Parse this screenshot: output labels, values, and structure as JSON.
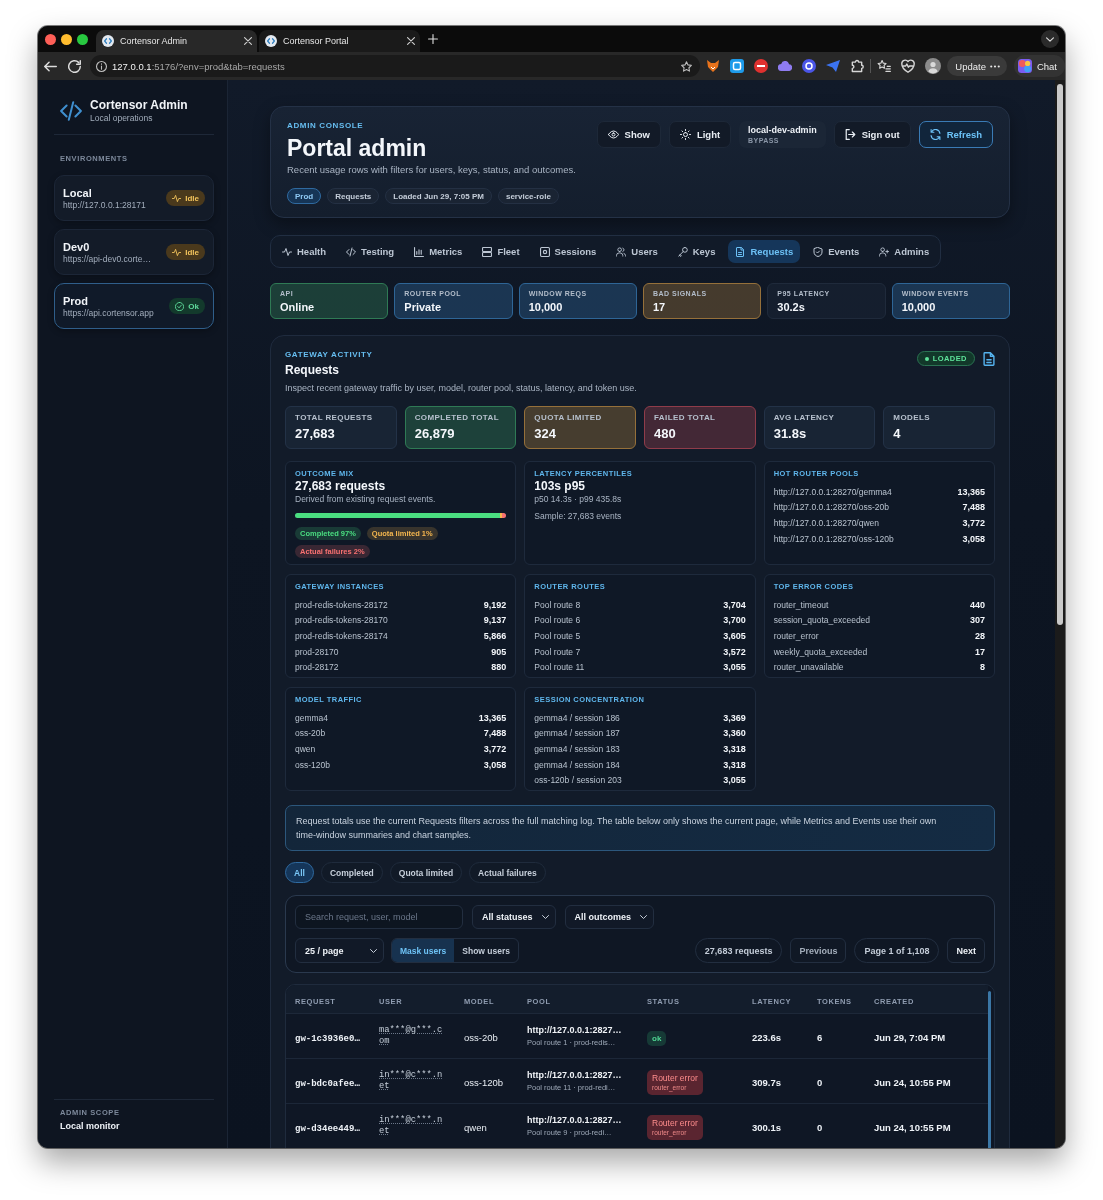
{
  "browser": {
    "tabs": [
      {
        "title": "Cortensor Admin",
        "selected": true
      },
      {
        "title": "Cortensor Portal",
        "selected": false
      }
    ],
    "url": {
      "host": "127.0.0.1",
      "path": ":5176/?env=prod&tab=requests"
    },
    "update_button": "Update",
    "chat_button": "Chat"
  },
  "sidebar": {
    "title": "Cortensor Admin",
    "subtitle": "Local operations",
    "section_label": "ENVIRONMENTS",
    "environments": [
      {
        "name": "Local",
        "url": "http://127.0.0.1:28171",
        "status": {
          "label": "Idle",
          "kind": "idle"
        },
        "selected": false
      },
      {
        "name": "Dev0",
        "url": "https://api-dev0.corte…",
        "status": {
          "label": "Idle",
          "kind": "idle"
        },
        "selected": false
      },
      {
        "name": "Prod",
        "url": "https://api.cortensor.app",
        "status": {
          "label": "Ok",
          "kind": "ok"
        },
        "selected": true
      }
    ],
    "footer_label": "ADMIN SCOPE",
    "footer_value": "Local monitor"
  },
  "header": {
    "eyebrow": "ADMIN CONSOLE",
    "title": "Portal admin",
    "description": "Recent usage rows with filters for users, keys, status, and outcomes.",
    "chips": [
      {
        "label": "Prod",
        "kind": "environment"
      },
      {
        "label": "Requests",
        "kind": "tag"
      },
      {
        "label": "Loaded Jun 29, 7:05 PM",
        "kind": "tag"
      },
      {
        "label": "service-role",
        "kind": "tag"
      }
    ],
    "show_button": "Show",
    "theme_button": "Light",
    "account": {
      "name": "local-dev-admin",
      "mode": "BYPASS"
    },
    "sign_out_button": "Sign out",
    "refresh_button": "Refresh"
  },
  "nav_tabs": [
    {
      "label": "Health",
      "selected": false
    },
    {
      "label": "Testing",
      "selected": false
    },
    {
      "label": "Metrics",
      "selected": false
    },
    {
      "label": "Fleet",
      "selected": false
    },
    {
      "label": "Sessions",
      "selected": false
    },
    {
      "label": "Users",
      "selected": false
    },
    {
      "label": "Keys",
      "selected": false
    },
    {
      "label": "Requests",
      "selected": true
    },
    {
      "label": "Events",
      "selected": false
    },
    {
      "label": "Admins",
      "selected": false
    }
  ],
  "stat_tiles": [
    {
      "label": "API",
      "value": "Online",
      "color": "#2f7a55"
    },
    {
      "label": "ROUTER POOL",
      "value": "Private",
      "color": "#2e6596"
    },
    {
      "label": "WINDOW REQS",
      "value": "10,000",
      "color": "#2e6596"
    },
    {
      "label": "BAD SIGNALS",
      "value": "17",
      "color": "#95703a"
    },
    {
      "label": "P95 LATENCY",
      "value": "30.2s",
      "color": "#1f2a3b"
    },
    {
      "label": "WINDOW EVENTS",
      "value": "10,000",
      "color": "#2e6596"
    }
  ],
  "requests": {
    "eyebrow": "GATEWAY ACTIVITY",
    "title": "Requests",
    "description": "Inspect recent gateway traffic by user, model, router pool, status, latency, and token use.",
    "status_badge": "LOADED",
    "totals": [
      {
        "label": "TOTAL REQUESTS",
        "value": "27,683",
        "color": "#233247"
      },
      {
        "label": "COMPLETED TOTAL",
        "value": "26,879",
        "color": "#2f7a55"
      },
      {
        "label": "QUOTA LIMITED",
        "value": "324",
        "color": "#95703a"
      },
      {
        "label": "FAILED TOTAL",
        "value": "480",
        "color": "#8f3c4a"
      },
      {
        "label": "AVG LATENCY",
        "value": "31.8s",
        "color": "#233247"
      },
      {
        "label": "MODELS",
        "value": "4",
        "color": "#233247"
      }
    ],
    "cards": [
      {
        "kind": "outcome",
        "title": "OUTCOME MIX",
        "headline": "27,683 requests",
        "note": "Derived from existing request events.",
        "outcomes": [
          {
            "label": "Completed 97%",
            "level": 0.97,
            "color": "#4ade80"
          },
          {
            "label": "Quota limited 1%",
            "level": 0.01,
            "color": "#f5b74f"
          },
          {
            "label": "Actual failures 2%",
            "level": 0.02,
            "color": "#f87171"
          }
        ]
      },
      {
        "kind": "latency",
        "title": "LATENCY PERCENTILES",
        "headline": "103s p95",
        "detail": "p50 14.3s · p99 435.8s",
        "sample": "Sample: 27,683 events"
      },
      {
        "kind": "list",
        "title": "HOT ROUTER POOLS",
        "rows": [
          {
            "label": "http://127.0.0.1:28270/gemma4",
            "value": "13,365"
          },
          {
            "label": "http://127.0.0.1:28270/oss-20b",
            "value": "7,488"
          },
          {
            "label": "http://127.0.0.1:28270/qwen",
            "value": "3,772"
          },
          {
            "label": "http://127.0.0.1:28270/oss-120b",
            "value": "3,058"
          }
        ]
      },
      {
        "kind": "list",
        "title": "GATEWAY INSTANCES",
        "rows": [
          {
            "label": "prod-redis-tokens-28172",
            "value": "9,192"
          },
          {
            "label": "prod-redis-tokens-28170",
            "value": "9,137"
          },
          {
            "label": "prod-redis-tokens-28174",
            "value": "5,866"
          },
          {
            "label": "prod-28170",
            "value": "905"
          },
          {
            "label": "prod-28172",
            "value": "880"
          }
        ]
      },
      {
        "kind": "list",
        "title": "ROUTER ROUTES",
        "rows": [
          {
            "label": "Pool route 8",
            "value": "3,704"
          },
          {
            "label": "Pool route 6",
            "value": "3,700"
          },
          {
            "label": "Pool route 5",
            "value": "3,605"
          },
          {
            "label": "Pool route 7",
            "value": "3,572"
          },
          {
            "label": "Pool route 11",
            "value": "3,055"
          }
        ]
      },
      {
        "kind": "list",
        "title": "TOP ERROR CODES",
        "rows": [
          {
            "label": "router_timeout",
            "value": "440"
          },
          {
            "label": "session_quota_exceeded",
            "value": "307"
          },
          {
            "label": "router_error",
            "value": "28"
          },
          {
            "label": "weekly_quota_exceeded",
            "value": "17"
          },
          {
            "label": "router_unavailable",
            "value": "8"
          }
        ]
      },
      {
        "kind": "list",
        "title": "MODEL TRAFFIC",
        "rows": [
          {
            "label": "gemma4",
            "value": "13,365"
          },
          {
            "label": "oss-20b",
            "value": "7,488"
          },
          {
            "label": "qwen",
            "value": "3,772"
          },
          {
            "label": "oss-120b",
            "value": "3,058"
          }
        ]
      },
      {
        "kind": "list",
        "title": "SESSION CONCENTRATION",
        "rows": [
          {
            "label": "gemma4 / session 186",
            "value": "3,369"
          },
          {
            "label": "gemma4 / session 187",
            "value": "3,360"
          },
          {
            "label": "gemma4 / session 183",
            "value": "3,318"
          },
          {
            "label": "gemma4 / session 184",
            "value": "3,318"
          },
          {
            "label": "oss-120b / session 203",
            "value": "3,055"
          }
        ]
      }
    ],
    "note": "Request totals use the current Requests filters across the full matching log. The table below only shows the current page, while Metrics and Events use their own time-window summaries and chart samples.",
    "outcome_filters": [
      {
        "label": "All",
        "selected": true
      },
      {
        "label": "Completed",
        "selected": false
      },
      {
        "label": "Quota limited",
        "selected": false
      },
      {
        "label": "Actual failures",
        "selected": false
      }
    ],
    "filters": {
      "search": {
        "placeholder": "Search request, user, model"
      },
      "status_select": "All statuses",
      "outcome_select": "All outcomes",
      "page_size_select": "25 / page",
      "user_display": [
        {
          "label": "Mask users",
          "selected": true
        },
        {
          "label": "Show users",
          "selected": false
        }
      ],
      "result_count": "27,683 requests",
      "previous_button": {
        "label": "Previous",
        "disabled": true
      },
      "page_indicator": "Page 1 of 1,108",
      "next_button": {
        "label": "Next",
        "disabled": false
      }
    },
    "table": {
      "columns": [
        "REQUEST",
        "USER",
        "MODEL",
        "POOL",
        "STATUS",
        "LATENCY",
        "TOKENS",
        "CREATED"
      ],
      "rows": [
        {
          "request": "gw-1c3936e0…",
          "user": "ma***@g***.com",
          "model": "oss-20b",
          "pool": "http://127.0.0.1:2827…",
          "route": "Pool route 1 · prod-redis…",
          "status": {
            "label": "ok",
            "kind": "ok"
          },
          "latency": "223.6s",
          "tokens": "6",
          "created": "Jun 29, 7:04 PM"
        },
        {
          "request": "gw-bdc0afee…",
          "user": "in***@c***.net",
          "model": "oss-120b",
          "pool": "http://127.0.0.1:2827…",
          "route": "Pool route 11 · prod-redi…",
          "status": {
            "label": "Router error",
            "code": "router_error",
            "kind": "error"
          },
          "latency": "309.7s",
          "tokens": "0",
          "created": "Jun 24, 10:55 PM"
        },
        {
          "request": "gw-d34ee449…",
          "user": "in***@c***.net",
          "model": "qwen",
          "pool": "http://127.0.0.1:2827…",
          "route": "Pool route 9 · prod-redi…",
          "status": {
            "label": "Router error",
            "code": "router_error",
            "kind": "error"
          },
          "latency": "300.1s",
          "tokens": "0",
          "created": "Jun 24, 10:55 PM"
        }
      ]
    }
  }
}
